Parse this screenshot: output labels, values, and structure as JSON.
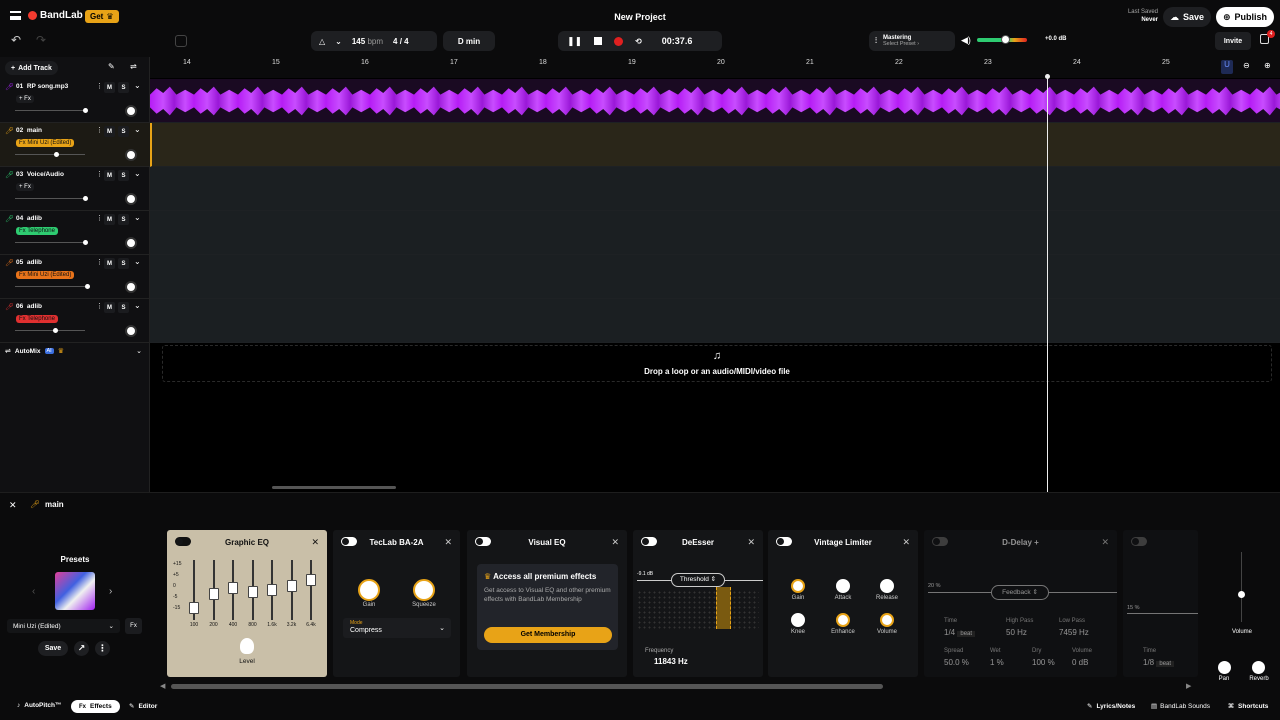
{
  "header": {
    "logo": "BandLab",
    "get_label": "Get",
    "project_title": "New Project",
    "last_saved_label": "Last Saved",
    "last_saved_value": "Never",
    "save_label": "Save",
    "publish_label": "Publish"
  },
  "toolbar": {
    "bpm_value": "145",
    "bpm_unit": "bpm",
    "time_signature": "4 / 4",
    "key": "D min",
    "time_display": "00:37.6",
    "mastering_label": "Mastering",
    "select_preset_label": "Select Preset ›",
    "volume_db": "+0.0 dB",
    "volume_level": 0.55,
    "invite_label": "Invite",
    "notification_count": "4"
  },
  "tracks_panel": {
    "add_track_label": "Add Track",
    "automix_label": "AutoMix",
    "ai_badge": "AI"
  },
  "ruler": {
    "bars": [
      "14",
      "15",
      "16",
      "17",
      "18",
      "19",
      "20",
      "21",
      "22",
      "23",
      "24",
      "25"
    ]
  },
  "tracks": [
    {
      "number": "01",
      "name": "RP song.mp3",
      "fx": "+ Fx",
      "fx_color": "#1b1c1f",
      "color": "#a020f0",
      "volume": 0.97
    },
    {
      "number": "02",
      "name": "main",
      "fx": "Fx Mini Uzi (Edited)",
      "fx_color": "#e8a317",
      "color": "#e8a317",
      "volume": 0.57
    },
    {
      "number": "03",
      "name": "Voice/Audio",
      "fx": "+ Fx",
      "fx_color": "#1b1c1f",
      "color": "#2ecc71",
      "volume": 0.97
    },
    {
      "number": "04",
      "name": "adlib",
      "fx": "Fx Telephone",
      "fx_color": "#2ecc71",
      "color": "#2ecc71",
      "volume": 0.97
    },
    {
      "number": "05",
      "name": "adlib",
      "fx": "Fx Mini Uzi (Edited)",
      "fx_color": "#e8731a",
      "color": "#e8731a",
      "volume": 1.0
    },
    {
      "number": "06",
      "name": "adlib",
      "fx": "Fx Telephone",
      "fx_color": "#e03030",
      "color": "#e03030",
      "volume": 0.55
    }
  ],
  "track_buttons": {
    "mute": "M",
    "solo": "S"
  },
  "drop_zone": {
    "text": "Drop a loop or an audio/MIDI/video file"
  },
  "fx_panel": {
    "track_name": "main",
    "presets_label": "Presets",
    "preset_name": "Mini Uzi (Edited)",
    "save_label": "Save"
  },
  "effects": {
    "graphic_eq": {
      "title": "Graphic EQ",
      "db_labels": [
        "+15",
        "+5",
        "0",
        "-5",
        "-15"
      ],
      "bands": [
        "100",
        "200",
        "400",
        "800",
        "1.6k",
        "3.2k",
        "6.4k"
      ],
      "level_label": "Level"
    },
    "ba2a": {
      "title": "TecLab BA-2A",
      "gain_label": "Gain",
      "squeeze_label": "Squeeze",
      "mode_label": "Mode",
      "mode_value": "Compress"
    },
    "visual_eq": {
      "title": "Visual EQ",
      "promo_title": "Access all premium effects",
      "promo_text": "Get access to Visual EQ and other premium effects with BandLab Membership",
      "cta": "Get Membership"
    },
    "deesser": {
      "title": "DeEsser",
      "db": "-9.1 dB",
      "threshold_label": "Threshold",
      "frequency_label": "Frequency",
      "frequency_value": "11843 Hz"
    },
    "limiter": {
      "title": "Vintage Limiter",
      "knobs": [
        "Gain",
        "Attack",
        "Release",
        "Knee",
        "Enhance",
        "Volume"
      ]
    },
    "ddelay": {
      "title": "D-Delay +",
      "percent": "20 %",
      "feedback_label": "Feedback",
      "time_label": "Time",
      "time_value": "1/4",
      "beat": "beat",
      "highpass_label": "High Pass",
      "highpass_value": "50 Hz",
      "lowpass_label": "Low Pass",
      "lowpass_value": "7459 Hz",
      "spread_label": "Spread",
      "spread_value": "50.0 %",
      "wet_label": "Wet",
      "wet_value": "1 %",
      "dry_label": "Dry",
      "dry_value": "100 %",
      "volume_label": "Volume",
      "volume_value": "0 dB"
    },
    "next": {
      "percent": "15 %",
      "time_label": "Time",
      "time_value": "1/8",
      "beat": "beat"
    }
  },
  "master_fader": {
    "volume_label": "Volume",
    "pan_label": "Pan",
    "reverb_label": "Reverb"
  },
  "bottom": {
    "autopitch": "AutoPitch™",
    "effects": "Effects",
    "editor": "Editor",
    "lyrics": "Lyrics/Notes",
    "sounds": "BandLab Sounds",
    "shortcuts": "Shortcuts"
  }
}
